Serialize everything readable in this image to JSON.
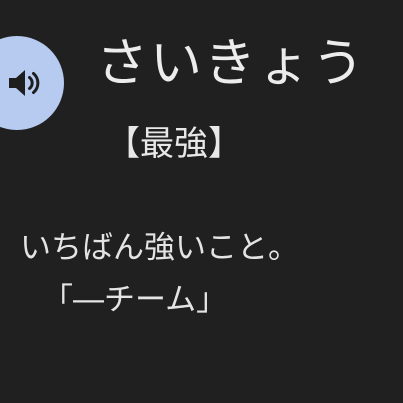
{
  "entry": {
    "reading": "さいきょう",
    "kanji": "【最強】",
    "definition": "いちばん強いこと。",
    "example": "「―チーム」"
  },
  "speaker": {
    "icon": "speaker-icon",
    "color": "#b7cbf0"
  },
  "theme": {
    "background": "#202020",
    "text": "#e8e8e8"
  }
}
